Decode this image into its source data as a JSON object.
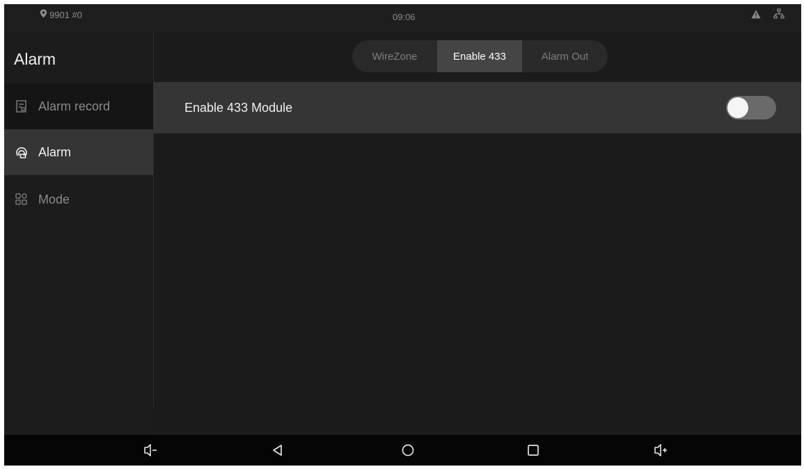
{
  "status_bar": {
    "location_text": "9901 #0",
    "time": "09:06"
  },
  "sidebar": {
    "title": "Alarm",
    "items": [
      {
        "label": "Alarm record",
        "icon": "document-icon",
        "active": false
      },
      {
        "label": "Alarm",
        "icon": "alarm-icon",
        "active": true
      },
      {
        "label": "Mode",
        "icon": "grid-icon",
        "active": false
      }
    ]
  },
  "tabs": [
    {
      "label": "WireZone",
      "active": false
    },
    {
      "label": "Enable 433",
      "active": true
    },
    {
      "label": "Alarm Out",
      "active": false
    }
  ],
  "settings": {
    "enable_433_label": "Enable 433 Module",
    "enable_433_on": false
  },
  "navbar": {
    "buttons": [
      "volume-down-icon",
      "back-icon",
      "home-icon",
      "recents-icon",
      "volume-up-icon"
    ]
  },
  "colors": {
    "background": "#1b1b1b",
    "active_item": "#353535",
    "text_primary": "#f2f2f2",
    "text_secondary": "#8a8a8a"
  }
}
